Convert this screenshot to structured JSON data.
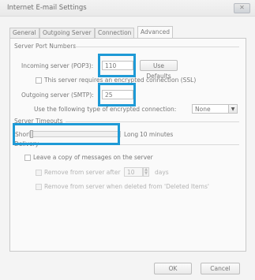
{
  "window": {
    "title": "Internet E-mail Settings",
    "close_glyph": "✕"
  },
  "tabs": [
    "General",
    "Outgoing Server",
    "Connection",
    "Advanced"
  ],
  "active_tab": "Advanced",
  "server_ports": {
    "group_title": "Server Port Numbers",
    "incoming_label": "Incoming server (POP3):",
    "incoming_value": "110",
    "use_defaults_label": "Use Defaults",
    "ssl_label": "This server requires an encrypted connection (SSL)",
    "outgoing_label": "Outgoing server (SMTP):",
    "outgoing_value": "25",
    "encryption_label": "Use the following type of encrypted connection:",
    "encryption_value": "None"
  },
  "timeouts": {
    "group_title": "Server Timeouts",
    "short_label": "Short",
    "long_label": "Long",
    "timeout_value": "10 minutes"
  },
  "delivery": {
    "group_title": "Delivery",
    "leave_copy_label": "Leave a copy of messages on the server",
    "remove_after_label": "Remove from server after",
    "remove_after_days": "10",
    "days_label": "days",
    "remove_deleted_label": "Remove from server when deleted from 'Deleted Items'"
  },
  "footer": {
    "ok_label": "OK",
    "cancel_label": "Cancel"
  },
  "colors": {
    "highlight": "#1e9ad6"
  }
}
